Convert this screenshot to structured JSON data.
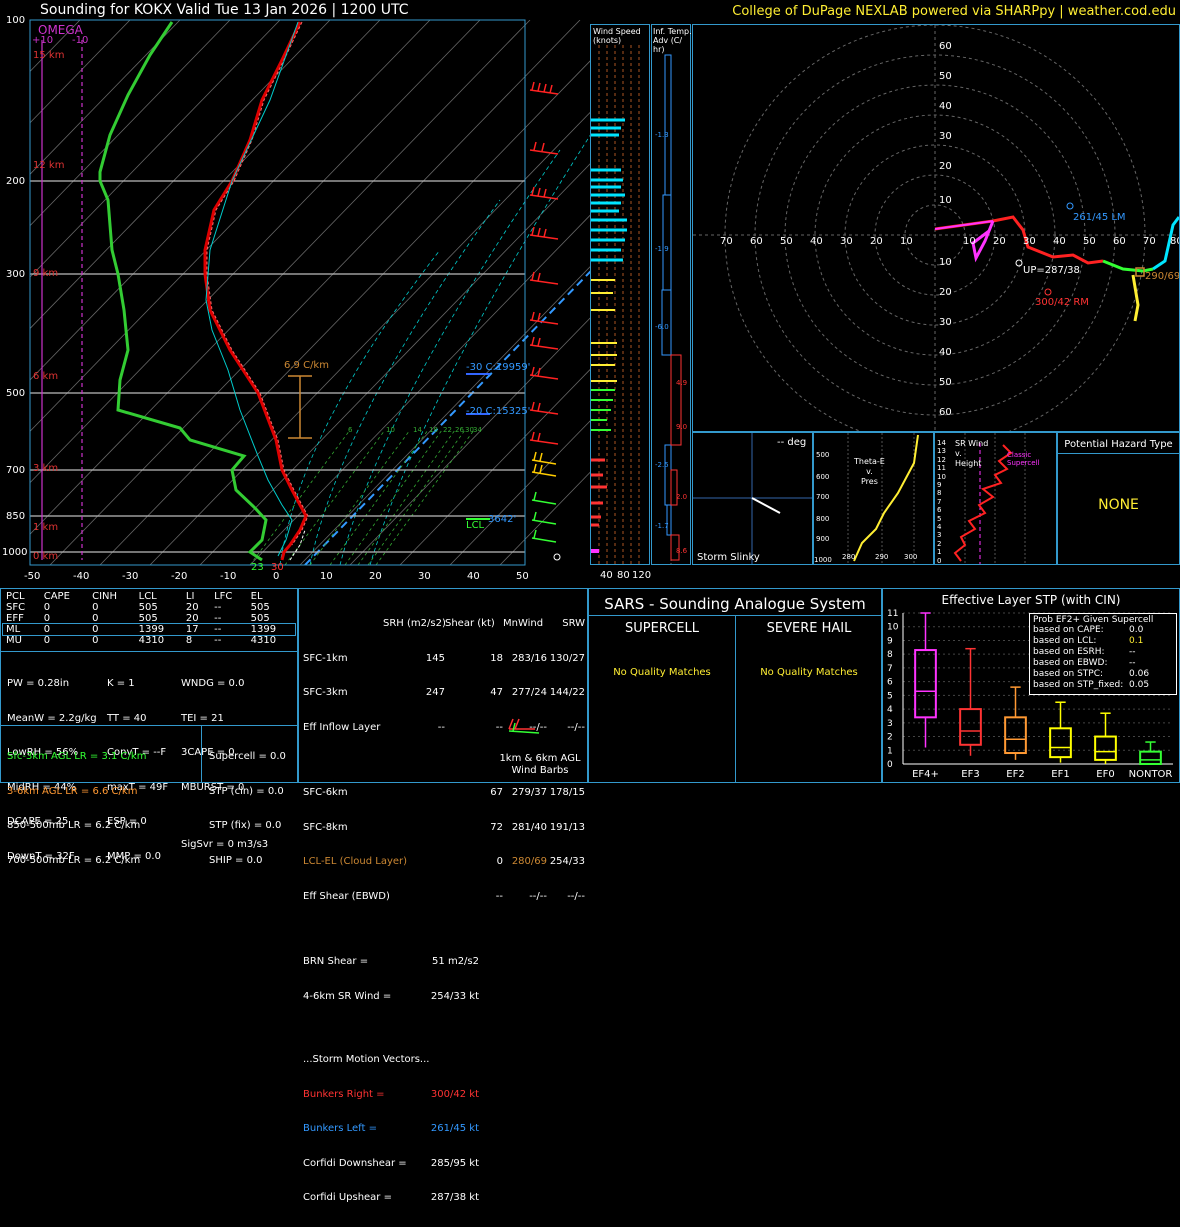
{
  "header": {
    "title": "Sounding for KOKX Valid  Tue 13 Jan 2026 | 1200 UTC",
    "credit": "College of DuPage NEXLAB powered via SHARPpy | weather.cod.edu"
  },
  "skewt": {
    "omega_title": "OMEGA",
    "omega_left": "+10",
    "omega_right": "-10",
    "pressure_ticks": [
      "100",
      "200",
      "300",
      "500",
      "700",
      "850",
      "1000"
    ],
    "temp_ticks": [
      "-50",
      "-40",
      "-30",
      "-20",
      "-10",
      "0",
      "10",
      "20",
      "30",
      "40",
      "50"
    ],
    "height_labels": [
      "15 km",
      "12 km",
      "9 km",
      "6 km",
      "3 km",
      "1 km",
      "0 km"
    ],
    "lapse_label": "6.9 C/km",
    "lvl_minus30": "-30 C:19959'",
    "lvl_minus20": "-20 C:15325'",
    "lvl_lcl_ft": "3642'",
    "lvl_lcl": "LCL",
    "sfc_t": "30",
    "sfc_td": "23",
    "mixing_ratio_labels": [
      "6",
      "10",
      "14",
      "18",
      "22",
      "26",
      "30",
      "34"
    ]
  },
  "wind_speed_panel": {
    "title": "Wind Speed\n(knots)",
    "ticks": [
      "40",
      "80",
      "120"
    ]
  },
  "temp_adv_panel": {
    "title": "Inf. Temp.\nAdv (C/\nhr)",
    "labels": [
      "-1.3",
      "-1.9",
      "-6.0",
      "4.9",
      "9.0",
      "-2.5",
      "2.0",
      "-1.7",
      "8.6"
    ]
  },
  "hodograph": {
    "ring_labels_up": [
      "60",
      "50",
      "40",
      "30",
      "20",
      "10"
    ],
    "ring_labels_down": [
      "10",
      "20",
      "30",
      "40",
      "50",
      "60"
    ],
    "axis_labels": [
      "70",
      "60",
      "50",
      "40",
      "30",
      "20",
      "10",
      "10",
      "20",
      "30",
      "40",
      "50",
      "60",
      "70",
      "80"
    ],
    "lm": "261/45 LM",
    "up": "UP=287/38",
    "rm": "300/42 RM",
    "dn": "290/69"
  },
  "storm_slinky": {
    "title": "Storm Slinky",
    "deg": "-- deg"
  },
  "theta_e": {
    "title": "Theta-E\nv.\nPres",
    "y_ticks": [
      "500",
      "600",
      "700",
      "800",
      "900",
      "1000"
    ],
    "x_ticks": [
      "280",
      "290",
      "300"
    ]
  },
  "sr_wind": {
    "title": "SR Wind\nv.\nHeight",
    "classic": "Classic\nSupercell",
    "y_ticks": [
      "14",
      "13",
      "12",
      "11",
      "10",
      "9",
      "8",
      "7",
      "6",
      "5",
      "4",
      "3",
      "2",
      "1",
      "0"
    ]
  },
  "hazard": {
    "title": "Potential Hazard Type",
    "value": "NONE"
  },
  "parcel_table": {
    "headers": [
      "PCL",
      "CAPE",
      "CINH",
      "LCL",
      "LI",
      "LFC",
      "EL"
    ],
    "rows": [
      [
        "SFC",
        "0",
        "0",
        "505",
        "20",
        "--",
        "505"
      ],
      [
        "EFF",
        "0",
        "0",
        "505",
        "20",
        "--",
        "505"
      ],
      [
        "ML",
        "0",
        "0",
        "1399",
        "17",
        "--",
        "1399"
      ],
      [
        "MU",
        "0",
        "0",
        "4310",
        "8",
        "--",
        "4310"
      ]
    ]
  },
  "thermo_indices": {
    "col1": [
      "PW = 0.28in",
      "MeanW = 2.2g/kg",
      "LowRH = 56%",
      "MidRH = 44%",
      "DCAPE = 25",
      "DownT = 32F"
    ],
    "col2": [
      "K = 1",
      "TT = 40",
      "ConvT = --F",
      "maxT = 49F",
      "ESP = 0",
      "MMP = 0.0"
    ],
    "col3": [
      "WNDG = 0.0",
      "TEI = 21",
      "3CAPE = 0",
      "MBURST = 0",
      "",
      "SigSvr = 0 m3/s3"
    ]
  },
  "lapse_rates": [
    {
      "label": "Sfc-3km AGL LR = 3.1 C/km",
      "color": "#33ff33"
    },
    {
      "label": "3-6km AGL LR = 6.6 C/km",
      "color": "#ff9933"
    },
    {
      "label": "850-500mb LR = 6.2 C/km",
      "color": "#ffffff"
    },
    {
      "label": "700-500mb LR = 6.2 C/km",
      "color": "#ffffff"
    }
  ],
  "composites": [
    "Supercell = 0.0",
    "STP (cin) = 0.0",
    "STP (fix) = 0.0",
    "SHIP = 0.0"
  ],
  "kinematics": {
    "headers": [
      "",
      "SRH (m2/s2)",
      "Shear (kt)",
      "MnWind",
      "SRW"
    ],
    "rows": [
      [
        "SFC-1km",
        "145",
        "18",
        "283/16",
        "130/27"
      ],
      [
        "SFC-3km",
        "247",
        "47",
        "277/24",
        "144/22"
      ],
      [
        "Eff Inflow Layer",
        "--",
        "--",
        "--/--",
        "--/--"
      ],
      [
        "",
        "",
        "",
        "",
        ""
      ],
      [
        "SFC-6km",
        "67",
        "279/37",
        "178/15",
        ""
      ],
      [
        "SFC-8km",
        "72",
        "281/40",
        "191/13",
        ""
      ],
      [
        "LCL-EL (Cloud Layer)",
        "0",
        "280/69",
        "254/33",
        ""
      ],
      [
        "Eff Shear (EBWD)",
        "--",
        "--/--",
        "--/--",
        ""
      ]
    ],
    "brn_shear": "BRN Shear =",
    "brn_shear_val": "51 m2/s2",
    "sr_wind_46": "4-6km SR Wind =",
    "sr_wind_46_val": "254/33 kt",
    "storm_vectors": "...Storm Motion Vectors...",
    "bunkers_right": "Bunkers Right =",
    "bunkers_right_val": "300/42 kt",
    "bunkers_left": "Bunkers Left =",
    "bunkers_left_val": "261/45 kt",
    "corfidi_down": "Corfidi Downshear =",
    "corfidi_down_val": "285/95 kt",
    "corfidi_up": "Corfidi Upshear =",
    "corfidi_up_val": "287/38 kt",
    "barbs_caption": "1km & 6km AGL\nWind Barbs"
  },
  "sars": {
    "title": "SARS - Sounding Analogue System",
    "supercell": "SUPERCELL",
    "severe_hail": "SEVERE HAIL",
    "supercell_msg": "No Quality Matches",
    "hail_msg": "No Quality Matches"
  },
  "stp_chart": {
    "title": "Effective Layer STP (with CIN)",
    "prob_title": "Prob EF2+ Given Supercell",
    "probs": [
      [
        "based on CAPE:",
        "0.0"
      ],
      [
        "based on LCL:",
        "0.1"
      ],
      [
        "based on ESRH:",
        "--"
      ],
      [
        "based on EBWD:",
        "--"
      ],
      [
        "based on STPC:",
        "0.06"
      ],
      [
        "based on STP_fixed:",
        "0.05"
      ]
    ]
  },
  "chart_data": {
    "type": "box",
    "title": "Effective Layer STP (with CIN)",
    "categories": [
      "EF4+",
      "EF3",
      "EF2",
      "EF1",
      "EF0",
      "NONTOR"
    ],
    "colors": [
      "#ff33ff",
      "#ff3333",
      "#ff9933",
      "#ffff00",
      "#ffff00",
      "#33ff33"
    ],
    "ylim": [
      0,
      11
    ],
    "yticks": [
      "0",
      "1",
      "2",
      "3",
      "4",
      "5",
      "6",
      "7",
      "8",
      "9",
      "10",
      "11"
    ],
    "boxes": [
      {
        "low": 1.2,
        "q1": 3.4,
        "median": 5.3,
        "q3": 8.3,
        "high": 11.0
      },
      {
        "low": 0.6,
        "q1": 1.4,
        "median": 2.4,
        "q3": 4.0,
        "high": 8.4
      },
      {
        "low": 0.3,
        "q1": 0.8,
        "median": 1.8,
        "q3": 3.4,
        "high": 5.6
      },
      {
        "low": 0.1,
        "q1": 0.5,
        "median": 1.2,
        "q3": 2.6,
        "high": 4.5
      },
      {
        "low": 0.0,
        "q1": 0.3,
        "median": 0.9,
        "q3": 2.0,
        "high": 3.7
      },
      {
        "low": 0.0,
        "q1": 0.0,
        "median": 0.3,
        "q3": 0.9,
        "high": 1.6
      }
    ]
  }
}
